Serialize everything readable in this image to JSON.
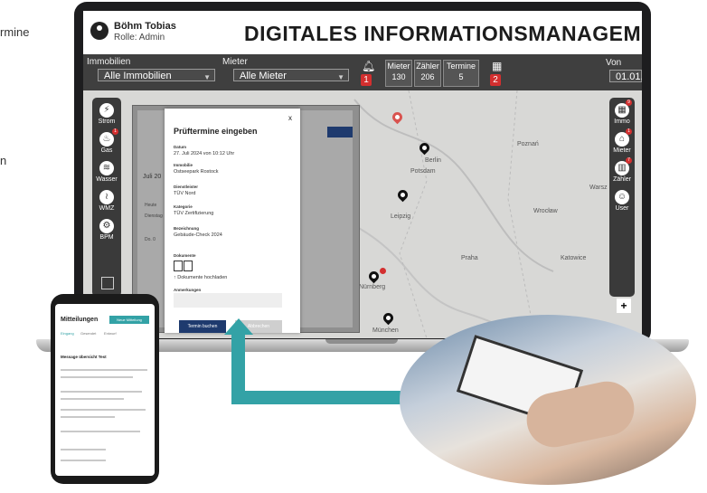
{
  "edge_text": [
    "rmine",
    "n"
  ],
  "user": {
    "name": "Böhm Tobias",
    "role": "Rolle: Admin"
  },
  "app_title": "DIGITALES INFORMATIONSMANAGEMENT",
  "filters": {
    "immobilien": {
      "label": "Immobilien",
      "value": "Alle Immobilien"
    },
    "mieter": {
      "label": "Mieter",
      "value": "Alle Mieter"
    },
    "von": {
      "label": "Von",
      "value": "01.01."
    }
  },
  "counters": {
    "bell_badge": "1",
    "mieter": {
      "label": "Mieter",
      "value": "130"
    },
    "zaehler": {
      "label": "Zähler",
      "value": "206"
    },
    "termine": {
      "label": "Termine",
      "value": "5"
    },
    "cal_badge": "2"
  },
  "sidebar_left": [
    {
      "icon": "lightning-icon",
      "label": "Strom",
      "badge": ""
    },
    {
      "icon": "flame-icon",
      "label": "Gas",
      "badge": "1"
    },
    {
      "icon": "water-icon",
      "label": "Wasser",
      "badge": ""
    },
    {
      "icon": "heat-icon",
      "label": "WMZ",
      "badge": ""
    },
    {
      "icon": "bpm-icon",
      "label": "BPM",
      "badge": ""
    }
  ],
  "sidebar_right": [
    {
      "icon": "building-icon",
      "label": "Immo",
      "badge": "9"
    },
    {
      "icon": "home-icon",
      "label": "Mieter",
      "badge": "1"
    },
    {
      "icon": "meter-icon",
      "label": "Zähler",
      "badge": "7"
    },
    {
      "icon": "users-icon",
      "label": "User",
      "badge": ""
    }
  ],
  "cities": [
    "Berlin",
    "Potsdam",
    "Leipzig",
    "Nürnberg",
    "München",
    "Praha",
    "Katowice",
    "Wrocław",
    "Poznań",
    "Warsz"
  ],
  "panel": {
    "date": "Juli 20",
    "mini": [
      "Heute",
      "Dienstag",
      "Do. 0"
    ]
  },
  "modal": {
    "close": "x",
    "title": "Prüftermine eingeben",
    "datum_label": "Datum",
    "datum_value": "27. Juli 2024 von 10:12 Uhr",
    "immobilie_label": "Immobilie",
    "immobilie_value": "Ostseepark Rostock",
    "dienstleister_label": "Dienstleister",
    "dienstleister_value": "TÜV Nord",
    "kategorie_label": "Kategorie",
    "kategorie_value": "TÜV Zertifizierung",
    "bezeichnung_label": "Bezeichnung",
    "bezeichnung_value": "Gebäude-Check 2024",
    "dokumente_label": "Dokumente",
    "upload_label": "Dokumente hochladen",
    "anmerkungen_label": "Anmerkungen",
    "submit": "Termin buchen",
    "cancel": "Abbrechen"
  },
  "phone": {
    "title": "Mitteilungen",
    "action": "Neue Mitteilung",
    "tabs": [
      "Eingang",
      "Gesendet",
      "Entwurf"
    ],
    "subject": "Message übersicht Test"
  },
  "colors": {
    "accent": "#33a2a6",
    "header_bar": "#3f3f3f",
    "badge": "#d32f2f",
    "button": "#1e3a6e"
  }
}
